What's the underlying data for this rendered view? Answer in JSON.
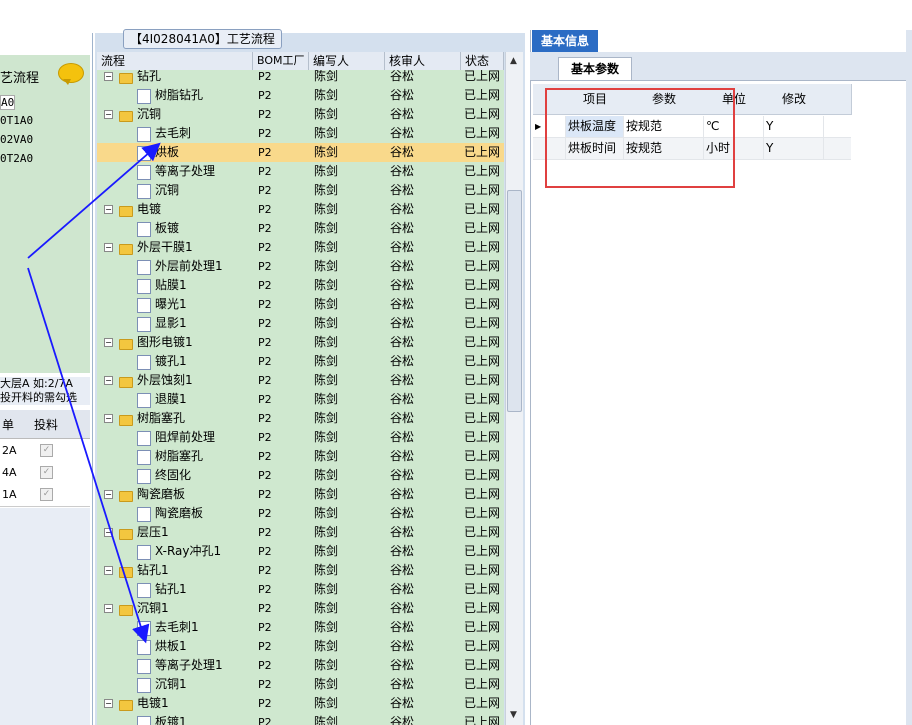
{
  "colors": {
    "tree_bg": "#cfe8cf",
    "selected": "#f9d98b",
    "tab_active": "#2b6cc4",
    "highlight_box": "#e04040",
    "arrow": "#1a1aff"
  },
  "left": {
    "title": "艺流程",
    "items": [
      "A0",
      "0T1A0",
      "02VA0",
      "0T2A0"
    ],
    "note": "大层A 如:2/7A\n投开料的需勾选",
    "grid_headers": [
      "单",
      "投料"
    ],
    "rows": [
      "2A",
      "4A",
      "1A"
    ]
  },
  "mid": {
    "title": "【4I028041A0】工艺流程",
    "columns": [
      "流程",
      "BOM工厂",
      "编写人",
      "核审人",
      "状态"
    ],
    "rows": [
      {
        "name": "钻孔",
        "type": "folder",
        "indent": 1
      },
      {
        "name": "树脂钻孔",
        "type": "doc",
        "indent": 2
      },
      {
        "name": "沉铜",
        "type": "folder",
        "indent": 1
      },
      {
        "name": "去毛刺",
        "type": "doc",
        "indent": 2
      },
      {
        "name": "烘板",
        "type": "doc",
        "indent": 2,
        "selected": true
      },
      {
        "name": "等离子处理",
        "type": "doc",
        "indent": 2
      },
      {
        "name": "沉铜",
        "type": "doc",
        "indent": 2
      },
      {
        "name": "电镀",
        "type": "folder",
        "indent": 1
      },
      {
        "name": "板镀",
        "type": "doc",
        "indent": 2
      },
      {
        "name": "外层干膜1",
        "type": "folder",
        "indent": 1
      },
      {
        "name": "外层前处理1",
        "type": "doc",
        "indent": 2
      },
      {
        "name": "贴膜1",
        "type": "doc",
        "indent": 2
      },
      {
        "name": "曝光1",
        "type": "doc",
        "indent": 2
      },
      {
        "name": "显影1",
        "type": "doc",
        "indent": 2
      },
      {
        "name": "图形电镀1",
        "type": "folder",
        "indent": 1
      },
      {
        "name": "镀孔1",
        "type": "doc",
        "indent": 2
      },
      {
        "name": "外层蚀刻1",
        "type": "folder",
        "indent": 1
      },
      {
        "name": "退膜1",
        "type": "doc",
        "indent": 2
      },
      {
        "name": "树脂塞孔",
        "type": "folder",
        "indent": 1
      },
      {
        "name": "阻焊前处理",
        "type": "doc",
        "indent": 2
      },
      {
        "name": "树脂塞孔",
        "type": "doc",
        "indent": 2
      },
      {
        "name": "终固化",
        "type": "doc",
        "indent": 2
      },
      {
        "name": "陶瓷磨板",
        "type": "folder",
        "indent": 1
      },
      {
        "name": "陶瓷磨板",
        "type": "doc",
        "indent": 2
      },
      {
        "name": "层压1",
        "type": "folder",
        "indent": 1
      },
      {
        "name": "X-Ray冲孔1",
        "type": "doc",
        "indent": 2
      },
      {
        "name": "钻孔1",
        "type": "folder",
        "indent": 1
      },
      {
        "name": "钻孔1",
        "type": "doc",
        "indent": 2
      },
      {
        "name": "沉铜1",
        "type": "folder",
        "indent": 1
      },
      {
        "name": "去毛刺1",
        "type": "doc",
        "indent": 2
      },
      {
        "name": "烘板1",
        "type": "doc",
        "indent": 2
      },
      {
        "name": "等离子处理1",
        "type": "doc",
        "indent": 2
      },
      {
        "name": "沉铜1",
        "type": "doc",
        "indent": 2
      },
      {
        "name": "电镀1",
        "type": "folder",
        "indent": 1
      },
      {
        "name": "板镀1",
        "type": "doc",
        "indent": 2
      }
    ],
    "bom": "P2",
    "writer": "陈剑",
    "reviewer": "谷松",
    "status": "已上网"
  },
  "right": {
    "tab": "基本信息",
    "subtab": "基本参数",
    "headers": [
      "项目",
      "参数",
      "单位",
      "修改"
    ],
    "rows": [
      {
        "item": "烘板温度",
        "param": "按规范",
        "unit": "℃",
        "edit": "Y"
      },
      {
        "item": "烘板时间",
        "param": "按规范",
        "unit": "小时",
        "edit": "Y"
      }
    ]
  }
}
